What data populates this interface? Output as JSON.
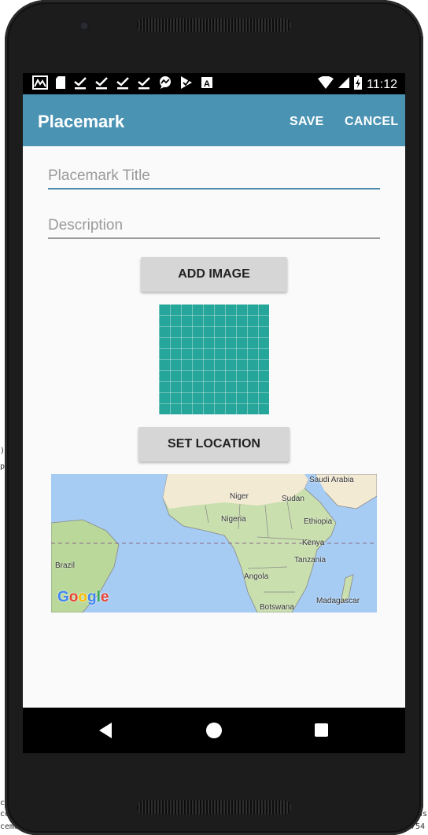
{
  "background_fragments": [
    ")",
    "p",
    ")",
    "us",
    "9754",
    "ce",
    "ce",
    "cema"
  ],
  "status_bar": {
    "notification_icons": [
      "gallery-icon",
      "sd-card-icon",
      "check-icon",
      "check-icon",
      "check-icon",
      "check-icon",
      "messenger-icon",
      "play-icon",
      "a-icon"
    ],
    "time": "11:12"
  },
  "toolbar": {
    "title": "Placemark",
    "save_label": "SAVE",
    "cancel_label": "CANCEL",
    "color": "#4a93b3"
  },
  "form": {
    "title_placeholder": "Placemark Title",
    "title_value": "",
    "description_placeholder": "Description",
    "description_value": "",
    "add_image_label": "ADD IMAGE",
    "set_location_label": "SET LOCATION"
  },
  "map": {
    "labels": [
      "Saudi Arabia",
      "Niger",
      "Sudan",
      "Nigeria",
      "Ethiopia",
      "Kenya",
      "Brazil",
      "Tanzania",
      "Angola",
      "Madagascar",
      "Botswana"
    ],
    "attribution": "Google"
  }
}
